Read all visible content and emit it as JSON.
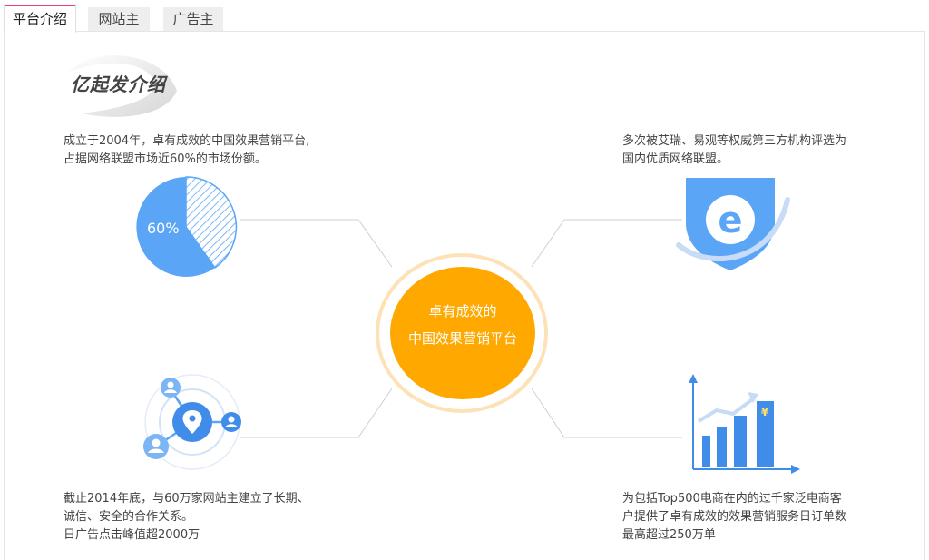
{
  "tabs": [
    {
      "label": "平台介绍",
      "active": true
    },
    {
      "label": "网站主",
      "active": false
    },
    {
      "label": "广告主",
      "active": false
    }
  ],
  "logo": {
    "text": "亿起发介绍"
  },
  "blocks": {
    "top_left": [
      "成立于2004年，卓有成效的中国效果营销平台,",
      "占据网络联盟市场近60%的市场份额。"
    ],
    "top_right": [
      "多次被艾瑞、易观等权威第三方机构评选为",
      "国内优质网络联盟。"
    ],
    "bottom_left": [
      "截止2014年底，与60万家网站主建立了长期、",
      "诚信、安全的合作关系。",
      "日广告点击峰值超2000万"
    ],
    "bottom_right": [
      "为包括Top500电商在内的过千家泛电商客",
      "户提供了卓有成效的效果营销服务日订单数",
      "最高超过250万单"
    ]
  },
  "center": {
    "line1": "卓有成效的",
    "line2": "中国效果营销平台"
  },
  "pie": {
    "label": "60%",
    "share": 0.6
  },
  "colors": {
    "accent": "#e8436e",
    "orange": "#fea800",
    "blue": "#5aa5f5",
    "ring": "#fde2b8"
  },
  "icons": [
    "pie-chart-icon",
    "shield-e-icon",
    "network-location-icon",
    "bar-chart-growth-icon"
  ],
  "bar_icon": {
    "currency": "¥"
  }
}
